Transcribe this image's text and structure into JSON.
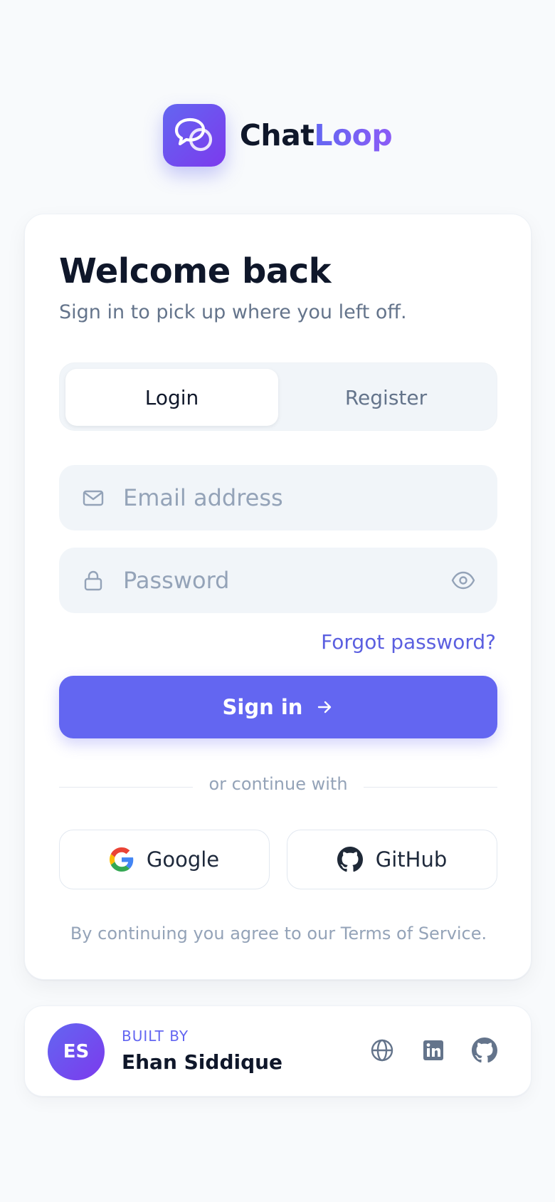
{
  "brand": {
    "name_part1": "Chat",
    "name_part2": "Loop",
    "logo_icon": "chat-bubbles-icon"
  },
  "card": {
    "title": "Welcome back",
    "subtitle": "Sign in to pick up where you left off.",
    "tabs": [
      {
        "label": "Login",
        "active": true
      },
      {
        "label": "Register",
        "active": false
      }
    ],
    "email": {
      "placeholder": "Email address",
      "value": "",
      "icon": "mail-icon"
    },
    "password": {
      "placeholder": "Password",
      "value": "",
      "icon": "lock-icon",
      "toggle_icon": "eye-icon"
    },
    "forgot_label": "Forgot password?",
    "signin_label": "Sign in",
    "divider_label": "or continue with",
    "social": {
      "google_label": "Google",
      "github_label": "GitHub"
    },
    "terms": "By continuing you agree to our Terms of Service."
  },
  "footer": {
    "avatar_initials": "ES",
    "built_by_label": "BUILT BY",
    "author_name": "Ehan Siddique",
    "links": [
      "globe-icon",
      "linkedin-icon",
      "github-icon"
    ]
  },
  "colors": {
    "accent": "#6366f1",
    "accent_dark": "#7c3aed",
    "background": "#f8fafc",
    "muted": "#94a3b8"
  }
}
